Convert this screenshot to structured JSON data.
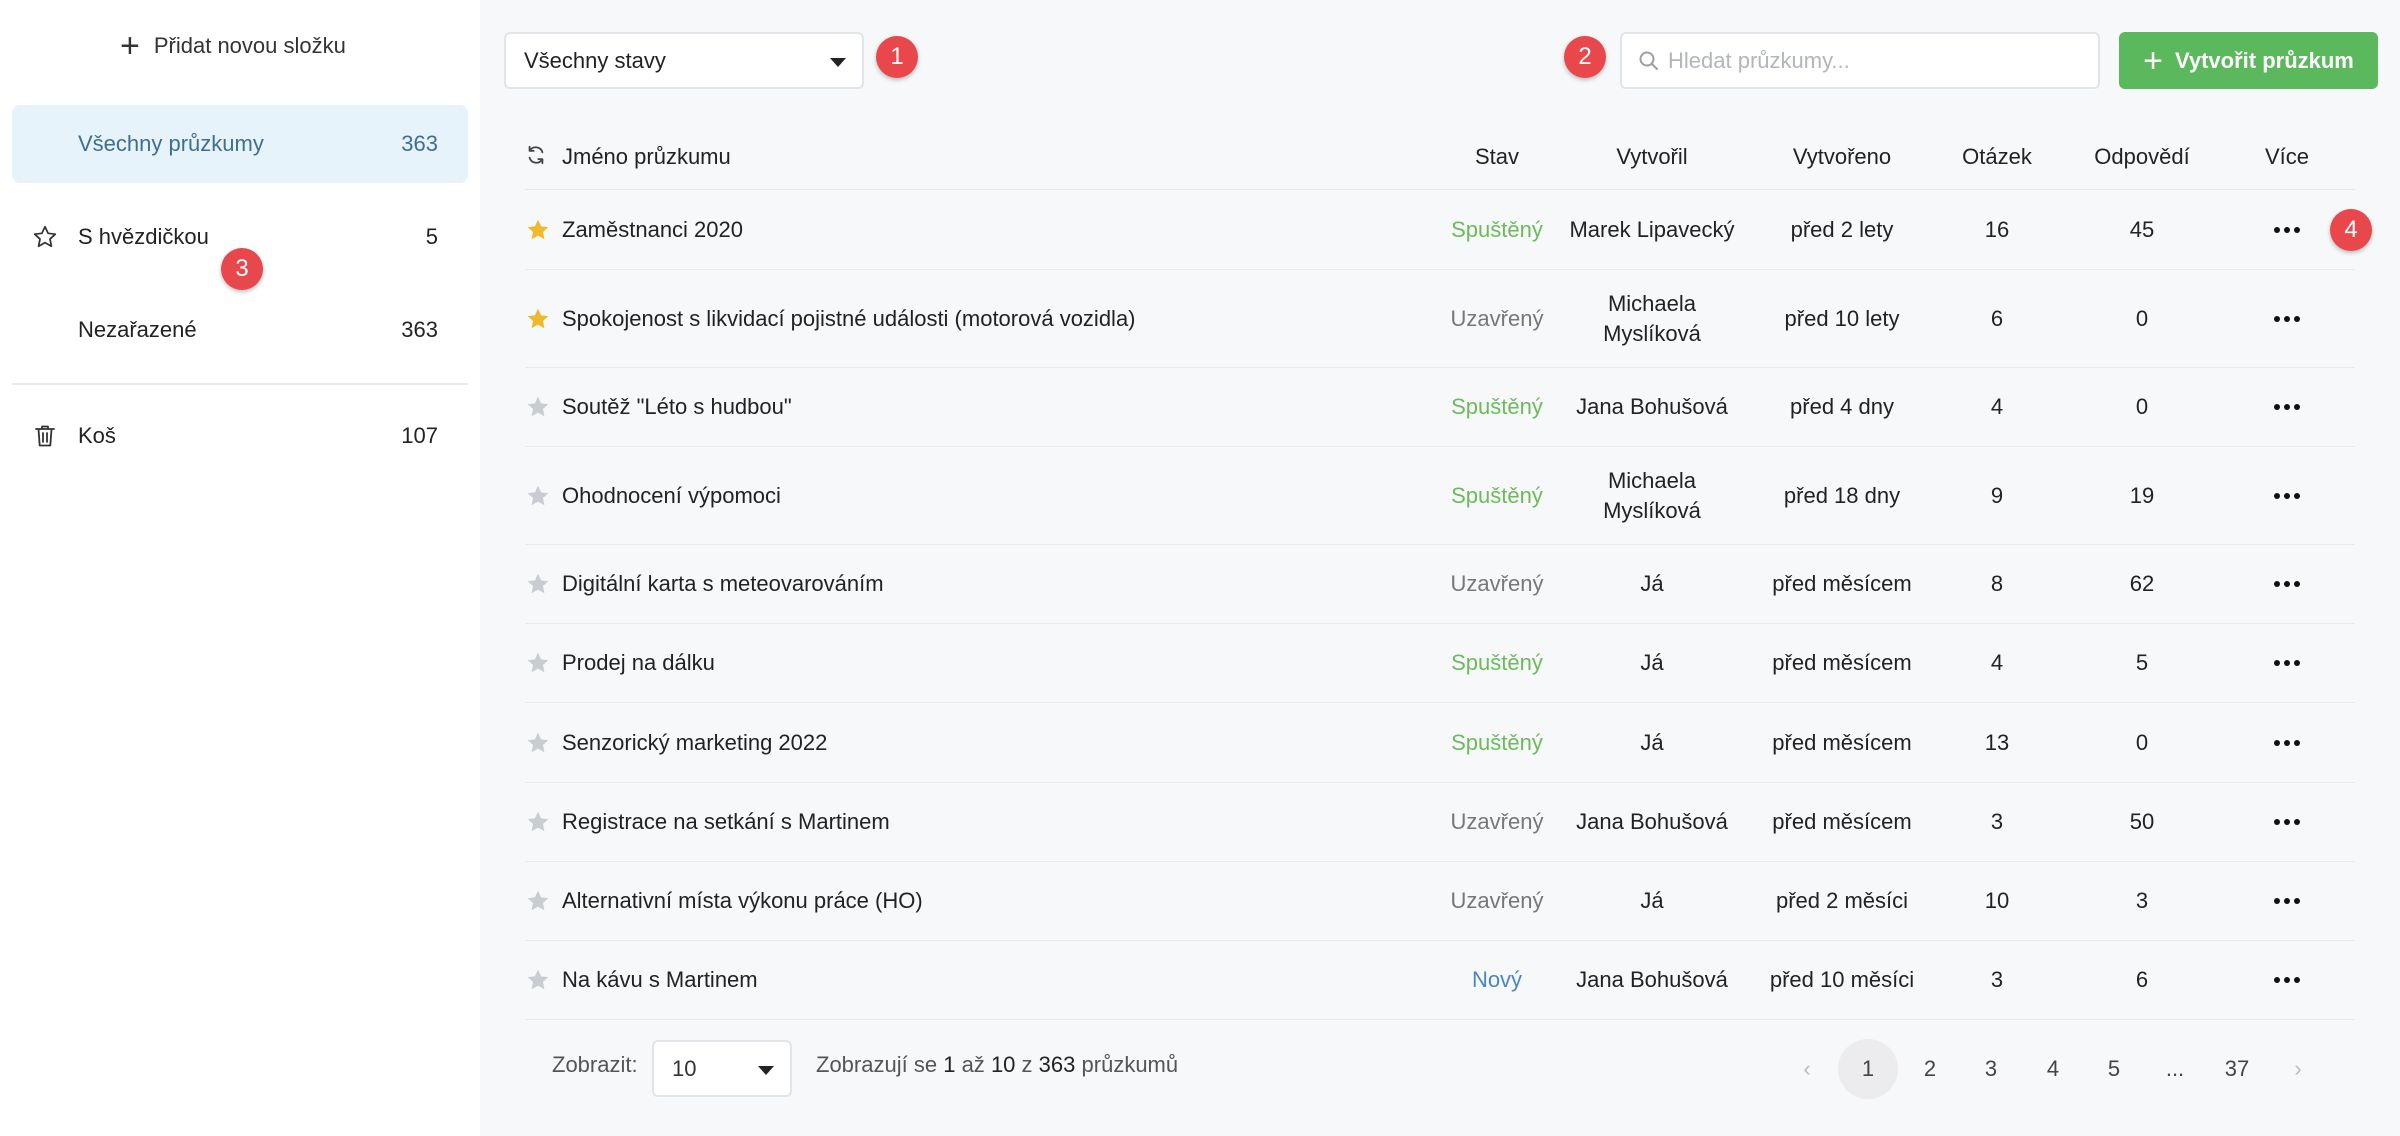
{
  "sidebar": {
    "add_folder": "Přidat novou složku",
    "folders": [
      {
        "label": "Všechny průzkumy",
        "count": "363"
      },
      {
        "label": "S hvězdičkou",
        "count": "5"
      },
      {
        "label": "Nezařazené",
        "count": "363"
      },
      {
        "label": "Koš",
        "count": "107"
      }
    ]
  },
  "toolbar": {
    "status_filter": "Všechny stavy",
    "search_placeholder": "Hledat průzkumy...",
    "create_label": "Vytvořit průzkum"
  },
  "badges": [
    "1",
    "2",
    "3",
    "4"
  ],
  "colors": {
    "accent_green": "#5cb85c",
    "status_running": "#6cbb5a",
    "status_closed": "#777777",
    "status_new": "#4a86c5",
    "star_active": "#f0b92a",
    "star_inactive": "#c9ccd0",
    "badge": "#e8474b",
    "active_folder_bg": "#e7f3fb"
  },
  "table": {
    "headers": {
      "name": "Jméno průzkumu",
      "status": "Stav",
      "created_by": "Vytvořil",
      "created": "Vytvořeno",
      "questions": "Otázek",
      "answers": "Odpovědí",
      "more": "Více"
    },
    "rows": [
      {
        "starred": true,
        "name": "Zaměstnanci 2020",
        "status": "Spuštěný",
        "status_type": "running",
        "by": "Marek Lipavecký",
        "created": "před 2 lety",
        "questions": "16",
        "answers": "45"
      },
      {
        "starred": true,
        "name": "Spokojenost s likvidací pojistné události (motorová vozidla)",
        "status": "Uzavřený",
        "status_type": "closed",
        "by": "Michaela Myslíková",
        "created": "před 10 lety",
        "questions": "6",
        "answers": "0"
      },
      {
        "starred": false,
        "name": "Soutěž \"Léto s hudbou\"",
        "status": "Spuštěný",
        "status_type": "running",
        "by": "Jana Bohušová",
        "created": "před 4 dny",
        "questions": "4",
        "answers": "0"
      },
      {
        "starred": false,
        "name": "Ohodnocení výpomoci",
        "status": "Spuštěný",
        "status_type": "running",
        "by": "Michaela Myslíková",
        "created": "před 18 dny",
        "questions": "9",
        "answers": "19"
      },
      {
        "starred": false,
        "name": "Digitální karta s meteovarováním",
        "status": "Uzavřený",
        "status_type": "closed",
        "by": "Já",
        "created": "před měsícem",
        "questions": "8",
        "answers": "62"
      },
      {
        "starred": false,
        "name": "Prodej na dálku",
        "status": "Spuštěný",
        "status_type": "running",
        "by": "Já",
        "created": "před měsícem",
        "questions": "4",
        "answers": "5"
      },
      {
        "starred": false,
        "name": "Senzorický marketing 2022",
        "status": "Spuštěný",
        "status_type": "running",
        "by": "Já",
        "created": "před měsícem",
        "questions": "13",
        "answers": "0"
      },
      {
        "starred": false,
        "name": "Registrace na setkání s Martinem",
        "status": "Uzavřený",
        "status_type": "closed",
        "by": "Jana Bohušová",
        "created": "před měsícem",
        "questions": "3",
        "answers": "50"
      },
      {
        "starred": false,
        "name": "Alternativní místa výkonu práce (HO)",
        "status": "Uzavřený",
        "status_type": "closed",
        "by": "Já",
        "created": "před 2 měsíci",
        "questions": "10",
        "answers": "3"
      },
      {
        "starred": false,
        "name": "Na kávu s Martinem",
        "status": "Nový",
        "status_type": "new",
        "by": "Jana Bohušová",
        "created": "před 10 měsíci",
        "questions": "3",
        "answers": "6"
      }
    ]
  },
  "footer": {
    "show_label": "Zobrazit:",
    "per_page": "10",
    "info_prefix": "Zobrazují se",
    "info_from": "1",
    "info_to_word": "až",
    "info_to": "10",
    "info_of_word": "z",
    "info_total": "363",
    "info_suffix": "průzkumů",
    "pages": [
      "1",
      "2",
      "3",
      "4",
      "5",
      "...",
      "37"
    ],
    "current_page": "1",
    "prev": "‹",
    "next": "›"
  }
}
